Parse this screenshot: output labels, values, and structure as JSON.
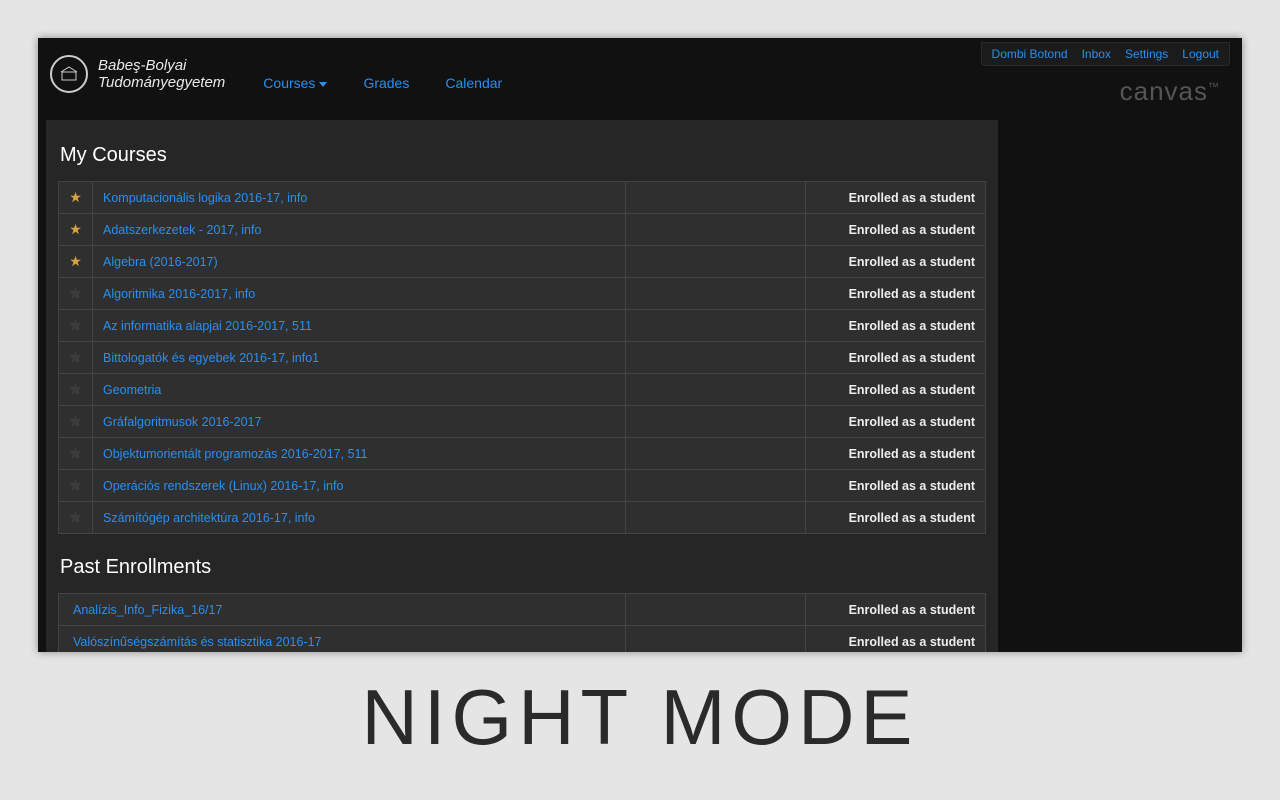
{
  "topbar": {
    "user": "Dombi Botond",
    "inbox": "Inbox",
    "settings": "Settings",
    "logout": "Logout"
  },
  "brand": {
    "line1": "Babeş-Bolyai",
    "line2": "Tudományegyetem"
  },
  "nav": {
    "courses": "Courses",
    "grades": "Grades",
    "calendar": "Calendar"
  },
  "platform_logo": "canvas",
  "platform_tm": "™",
  "sections": {
    "my_courses_title": "My Courses",
    "past_title": "Past Enrollments"
  },
  "role_text": "Enrolled as a student",
  "my_courses": [
    {
      "name": "Komputacionális logika 2016-17, info",
      "starred": true
    },
    {
      "name": "Adatszerkezetek - 2017, info",
      "starred": true
    },
    {
      "name": "Algebra (2016-2017)",
      "starred": true
    },
    {
      "name": "Algoritmika 2016-2017, info",
      "starred": false
    },
    {
      "name": "Az informatika alapjai 2016-2017, 511",
      "starred": false
    },
    {
      "name": "Bittologatók és egyebek 2016-17, info1",
      "starred": false
    },
    {
      "name": "Geometria",
      "starred": false
    },
    {
      "name": "Gráfalgoritmusok 2016-2017",
      "starred": false
    },
    {
      "name": "Objektumorientált programozás 2016-2017, 511",
      "starred": false
    },
    {
      "name": "Operációs rendszerek (Linux) 2016-17, info",
      "starred": false
    },
    {
      "name": "Számítógép architektúra 2016-17, info",
      "starred": false
    }
  ],
  "past_courses": [
    {
      "name": "Analízis_Info_Fizika_16/17"
    },
    {
      "name": "Valószínűségszámítás és statisztika 2016-17"
    }
  ],
  "caption": "NIGHT MODE"
}
